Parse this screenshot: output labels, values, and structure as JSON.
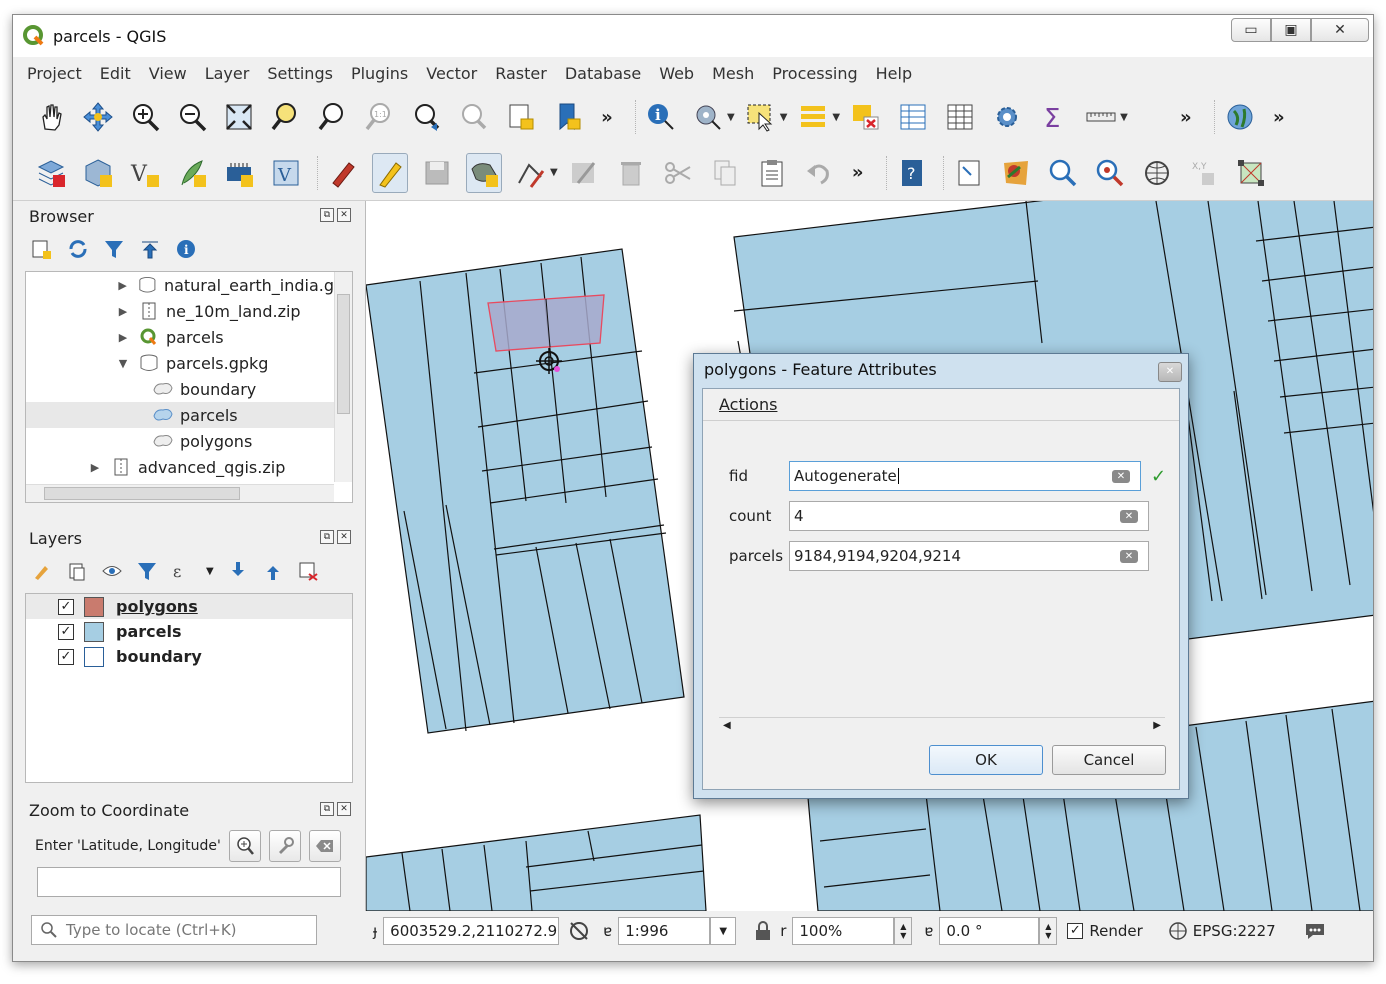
{
  "window": {
    "title": "parcels - QGIS"
  },
  "menu": [
    "Project",
    "Edit",
    "View",
    "Layer",
    "Settings",
    "Plugins",
    "Vector",
    "Raster",
    "Database",
    "Web",
    "Mesh",
    "Processing",
    "Help"
  ],
  "browser": {
    "title": "Browser",
    "items": [
      {
        "label": "natural_earth_india.g",
        "indent": 1,
        "icon": "database-icon",
        "arrow": "right"
      },
      {
        "label": "ne_10m_land.zip",
        "indent": 1,
        "icon": "zip-icon",
        "arrow": "right"
      },
      {
        "label": "parcels",
        "indent": 1,
        "icon": "qgis-project-icon",
        "arrow": "right"
      },
      {
        "label": "parcels.gpkg",
        "indent": 1,
        "icon": "database-icon",
        "arrow": "down"
      },
      {
        "label": "boundary",
        "indent": 2,
        "icon": "polygon-layer-icon",
        "arrow": ""
      },
      {
        "label": "parcels",
        "indent": 2,
        "icon": "polygon-layer-icon",
        "arrow": ""
      },
      {
        "label": "polygons",
        "indent": 2,
        "icon": "polygon-layer-icon",
        "arrow": ""
      },
      {
        "label": "advanced_qgis.zip",
        "indent": 0,
        "icon": "zip-icon",
        "arrow": "right"
      }
    ]
  },
  "layers": {
    "title": "Layers",
    "items": [
      {
        "label": "polygons",
        "checked": true,
        "color": "#c97b6e"
      },
      {
        "label": "parcels",
        "checked": true,
        "color": "#a6cee3"
      },
      {
        "label": "boundary",
        "checked": true,
        "color": "#ffffff"
      }
    ]
  },
  "zoom": {
    "title": "Zoom to Coordinate",
    "label": "Enter 'Latitude, Longitude'",
    "value": ""
  },
  "locator": {
    "placeholder": "Type to locate (Ctrl+K)"
  },
  "status": {
    "coord_label": "ɟ",
    "coordinate": "6003529.2,2110272.9",
    "scale_label": "ɐ",
    "scale": "1:996",
    "magnifier_label": "r",
    "magnifier": "100%",
    "rotation_label": "ɐ",
    "rotation": "0.0 °",
    "render_label": "Render",
    "render_checked": true,
    "crs": "EPSG:2227"
  },
  "dialog": {
    "title": "polygons - Feature Attributes",
    "actions_label": "Actions",
    "fields": [
      {
        "label": "fid",
        "value": "Autogenerate"
      },
      {
        "label": "count",
        "value": "4"
      },
      {
        "label": "parcels",
        "value": "9184,9194,9204,9214"
      }
    ],
    "ok_label": "OK",
    "cancel_label": "Cancel"
  },
  "colors": {
    "parcel_fill": "#a6cee3",
    "selection_outline": "#e84a5f",
    "selection_fill": "#a7a9cc"
  }
}
